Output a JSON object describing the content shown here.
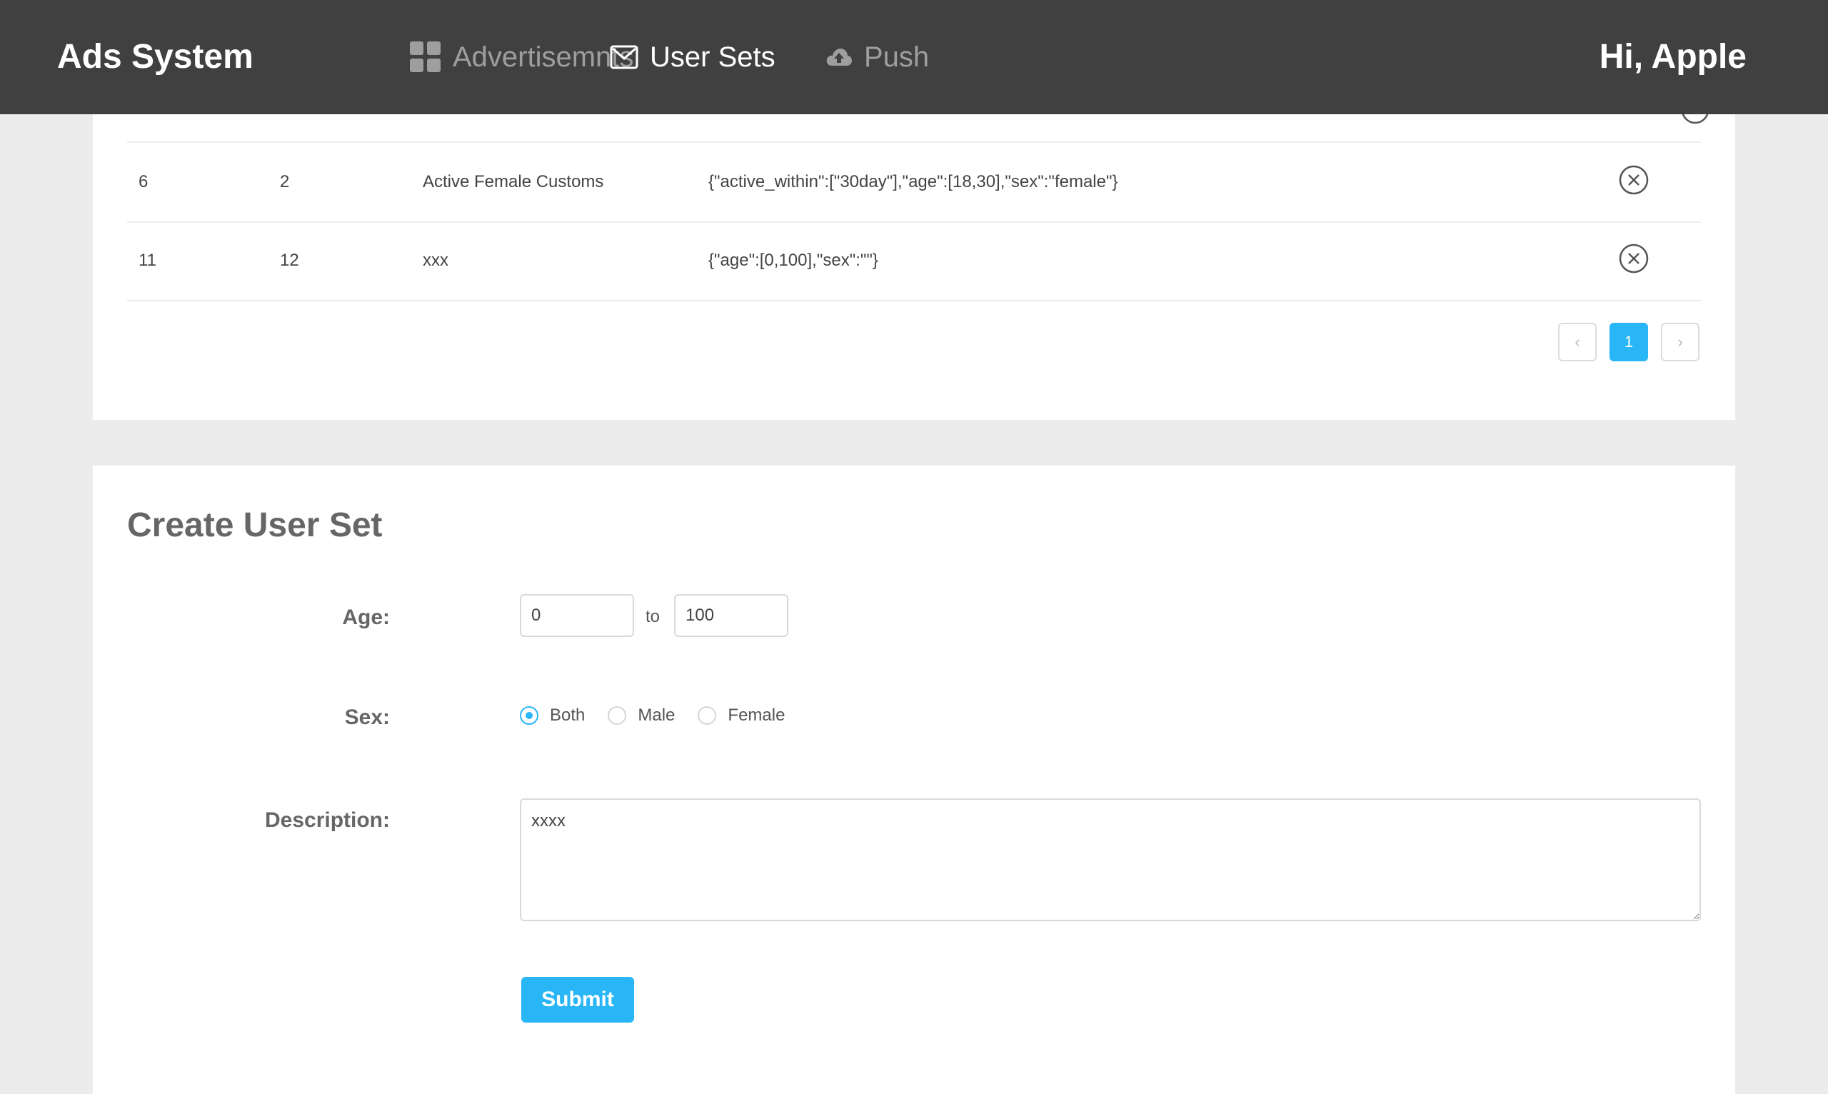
{
  "header": {
    "brand": "Ads System",
    "nav": [
      {
        "label": "Advertisemnts",
        "icon": "grid-icon"
      },
      {
        "label": "User Sets",
        "icon": "envelope-icon"
      },
      {
        "label": "Push",
        "icon": "cloud-upload-icon"
      }
    ],
    "active_nav": "User Sets",
    "greeting": "Hi, Apple"
  },
  "user_sets_table": {
    "rows": [
      {
        "id": "6",
        "count": "2",
        "description": "Active Female Customs",
        "conditions": "{\"active_within\":[\"30day\"],\"age\":[18,30],\"sex\":\"female\"}",
        "action_icon": "close-circle-icon"
      },
      {
        "id": "11",
        "count": "12",
        "description": "xxx",
        "conditions": "{\"age\":[0,100],\"sex\":\"\"}",
        "action_icon": "close-circle-icon"
      }
    ],
    "pagination": {
      "prev": "‹",
      "current_page": "1",
      "next": "›"
    }
  },
  "create_form": {
    "title": "Create User Set",
    "age_label": "Age:",
    "age_min": "0",
    "age_to": "to",
    "age_max": "100",
    "sex_label": "Sex:",
    "sex_options": [
      "Both",
      "Male",
      "Female"
    ],
    "sex_selected": "Both",
    "description_label": "Description:",
    "description_value": "xxxx",
    "submit_label": "Submit"
  },
  "colors": {
    "nav_bg": "#404040",
    "page_bg": "#ececec",
    "accent": "#29b6f6"
  }
}
